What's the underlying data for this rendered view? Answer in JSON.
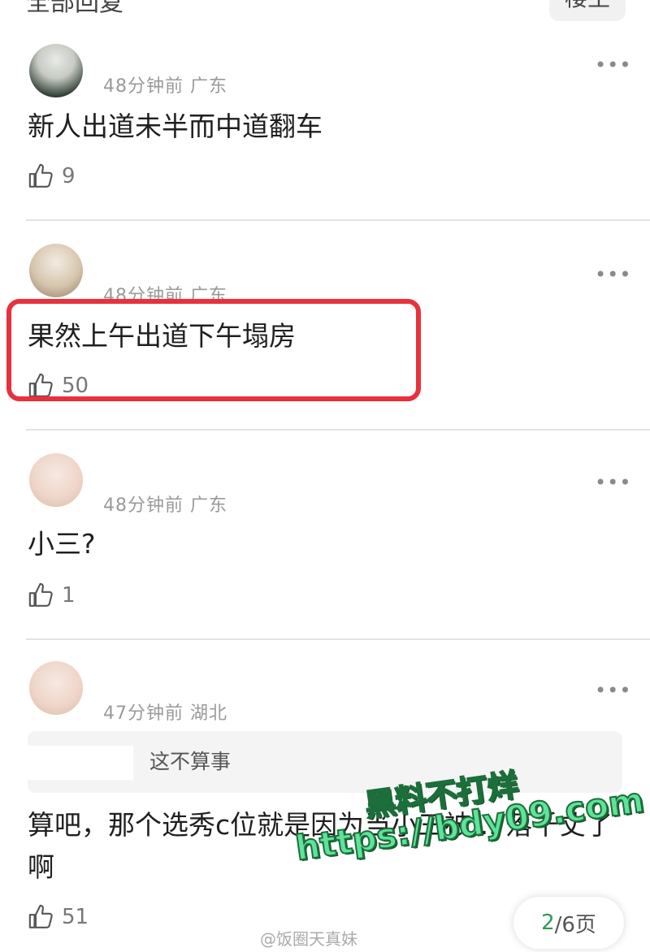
{
  "header": {
    "title": "全部回复",
    "button_label": "楼主"
  },
  "comments": [
    {
      "meta": "48分钟前 广东",
      "text": "新人出道未半而中道翻车",
      "likes": "9"
    },
    {
      "meta": "48分钟前 广东",
      "text": "果然上午出道下午塌房",
      "likes": "50"
    },
    {
      "meta": "48分钟前 广东",
      "text": "小三?",
      "likes": "1"
    },
    {
      "meta": "47分钟前 湖北",
      "quote": "这不算事",
      "text": "算吧，那个选秀c位就是因为当小三被... 落千丈了啊",
      "likes": "51"
    }
  ],
  "more_symbol": "•••",
  "pager": {
    "current": "2",
    "total": "/6页"
  },
  "watermark": {
    "line1": "黑料不打烊",
    "line2": "https://bdy09.com"
  },
  "weibo_credit": "@饭圈天真妹",
  "colors": {
    "highlight": "#e8313c",
    "watermark": "#5fe29a",
    "pager_current": "#2c9c55"
  },
  "icons": {
    "like": "thumbs-up-icon",
    "more": "more-dots-icon"
  }
}
